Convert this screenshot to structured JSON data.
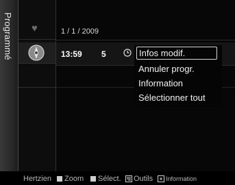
{
  "side_tab": {
    "label": "Programmé"
  },
  "icons": {
    "row1": "heart-icon",
    "row2": "clock-icon",
    "clock_small": "timer-icon"
  },
  "list": {
    "date": "1 / 1 / 2009",
    "program": {
      "time": "13:59",
      "channel": "5"
    }
  },
  "menu": {
    "items": [
      "Infos modif.",
      "Annuler progr.",
      "Information",
      "Sélectionner tout"
    ],
    "selected_index": 0
  },
  "help_bar": {
    "source": "Hertzien",
    "zoom": "Zoom",
    "select": "Sélect.",
    "tools": "Outils",
    "info": "Information"
  }
}
